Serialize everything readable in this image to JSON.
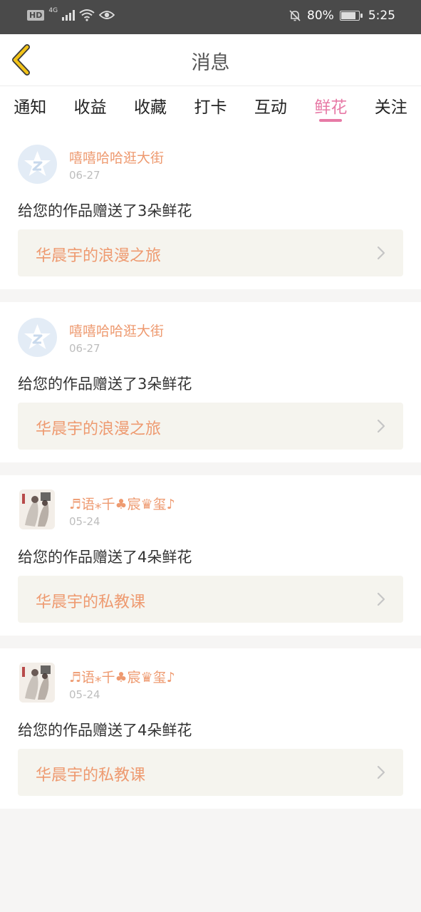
{
  "status_bar": {
    "hd": "HD",
    "network": "4G",
    "battery": "80%",
    "time": "5:25"
  },
  "header": {
    "title": "消息",
    "back_icon": "chevron-left-icon"
  },
  "tabs": [
    {
      "label": "通知",
      "active": false
    },
    {
      "label": "收益",
      "active": false
    },
    {
      "label": "收藏",
      "active": false
    },
    {
      "label": "打卡",
      "active": false
    },
    {
      "label": "互动",
      "active": false
    },
    {
      "label": "鲜花",
      "active": true
    },
    {
      "label": "关注",
      "active": false
    }
  ],
  "messages": [
    {
      "user": "嘻嘻哈哈逛大街",
      "date": "06-27",
      "text": "给您的作品赠送了3朵鲜花",
      "work": "华晨宇的浪漫之旅",
      "avatar": "qq-default-avatar"
    },
    {
      "user": "嘻嘻哈哈逛大街",
      "date": "06-27",
      "text": "给您的作品赠送了3朵鲜花",
      "work": "华晨宇的浪漫之旅",
      "avatar": "qq-default-avatar"
    },
    {
      "user": "♬语⁎千♣宸♛玺♪",
      "date": "05-24",
      "text": "给您的作品赠送了4朵鲜花",
      "work": "华晨宇的私教课",
      "avatar": "artwork-avatar"
    },
    {
      "user": "♬语⁎千♣宸♛玺♪",
      "date": "05-24",
      "text": "给您的作品赠送了4朵鲜花",
      "work": "华晨宇的私教课",
      "avatar": "artwork-avatar"
    }
  ],
  "colors": {
    "accent_pink": "#e77aa6",
    "name_orange": "#ee9a70",
    "card_bg": "#f5f4ee",
    "back_arrow": "#f2c318"
  }
}
